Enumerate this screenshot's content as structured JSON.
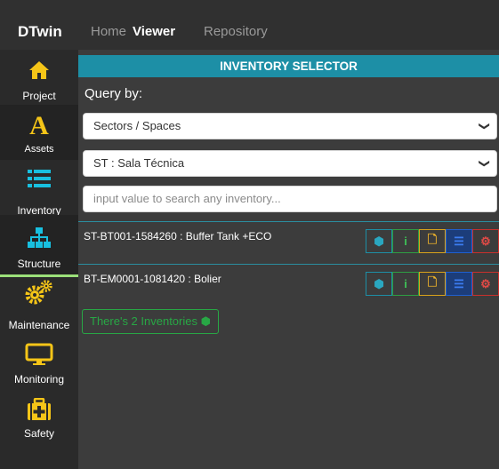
{
  "app": {
    "brand": "DTwin"
  },
  "nav": {
    "home": "Home",
    "viewer": "Viewer",
    "repository": "Repository"
  },
  "sidebar": {
    "items": [
      {
        "label": "Project",
        "icon": "home-icon",
        "color": "#f5c518"
      },
      {
        "label": "Assets",
        "icon": "assets-letter-icon",
        "color": "#f5c518"
      },
      {
        "label": "Inventory",
        "icon": "list-icon",
        "color": "#18c0e0"
      },
      {
        "label": "Structure",
        "icon": "sitemap-icon",
        "color": "#18c0e0"
      },
      {
        "label": "Maintenance",
        "icon": "gears-icon",
        "color": "#f5c518"
      },
      {
        "label": "Monitoring",
        "icon": "monitor-icon",
        "color": "#f5c518"
      },
      {
        "label": "Safety",
        "icon": "medkit-icon",
        "color": "#f5c518"
      }
    ],
    "assets_glyph": "A",
    "active": "Structure"
  },
  "selector": {
    "title": "INVENTORY SELECTOR",
    "query_label": "Query by:",
    "query_type": "Sectors / Spaces",
    "space": "ST : Sala Técnica",
    "search_placeholder": "input value to search any inventory...",
    "chevron": "❯"
  },
  "inventories": [
    {
      "label": "ST-BT001-1584260 : Buffer Tank +ECO"
    },
    {
      "label": "BT-EM0001-1081420 : Bolier"
    }
  ],
  "action_icons": {
    "cube": "⬢",
    "info": "i",
    "doc": "🗋",
    "list": "☰",
    "gears": "⚙"
  },
  "summary": {
    "count_text": "There's 2 Inventories",
    "cube_glyph": "⬢"
  },
  "colors": {
    "accent": "#1d8fa6",
    "brand_yellow": "#f5c518",
    "success": "#28a745"
  }
}
